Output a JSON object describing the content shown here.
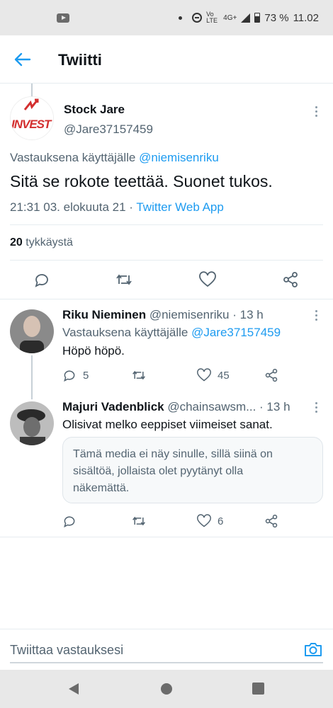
{
  "status_bar": {
    "network": "4G+",
    "volte": "Vo LTE",
    "battery": "73 %",
    "time": "11.02"
  },
  "header": {
    "title": "Twiitti"
  },
  "main_tweet": {
    "display_name": "Stock Jare",
    "handle": "@Jare37157459",
    "avatar_text": "INVEST",
    "reply_prefix": "Vastauksena käyttäjälle",
    "reply_to": "@niemisenriku",
    "text": "Sitä se rokote teettää. Suonet tukos.",
    "timestamp": "21:31 03. elokuuta 21",
    "separator": "·",
    "source": "Twitter Web App",
    "likes_count": "20",
    "likes_label": "tykkäystä"
  },
  "replies": [
    {
      "display_name": "Riku Nieminen",
      "handle": "@niemisenriku",
      "time": "· 13 h",
      "reply_prefix": "Vastauksena käyttäjälle",
      "reply_to": "@Jare37157459",
      "text": "Höpö höpö.",
      "reply_count": "5",
      "retweet_count": "",
      "like_count": "45"
    },
    {
      "display_name": "Majuri Vadenblick",
      "handle": "@chainsawsm...",
      "time": "· 13 h",
      "text": "Olisivat melko eeppiset viimeiset sanat.",
      "media_notice": "Tämä media ei näy sinulle, sillä siinä on sisältöä, jollaista olet pyytänyt olla näkemättä.",
      "reply_count": "",
      "retweet_count": "",
      "like_count": "6"
    }
  ],
  "reply_input": {
    "placeholder": "Twiittaa vastauksesi"
  },
  "colors": {
    "accent": "#1d9bf0",
    "text": "#0f1419",
    "muted": "#536471"
  }
}
